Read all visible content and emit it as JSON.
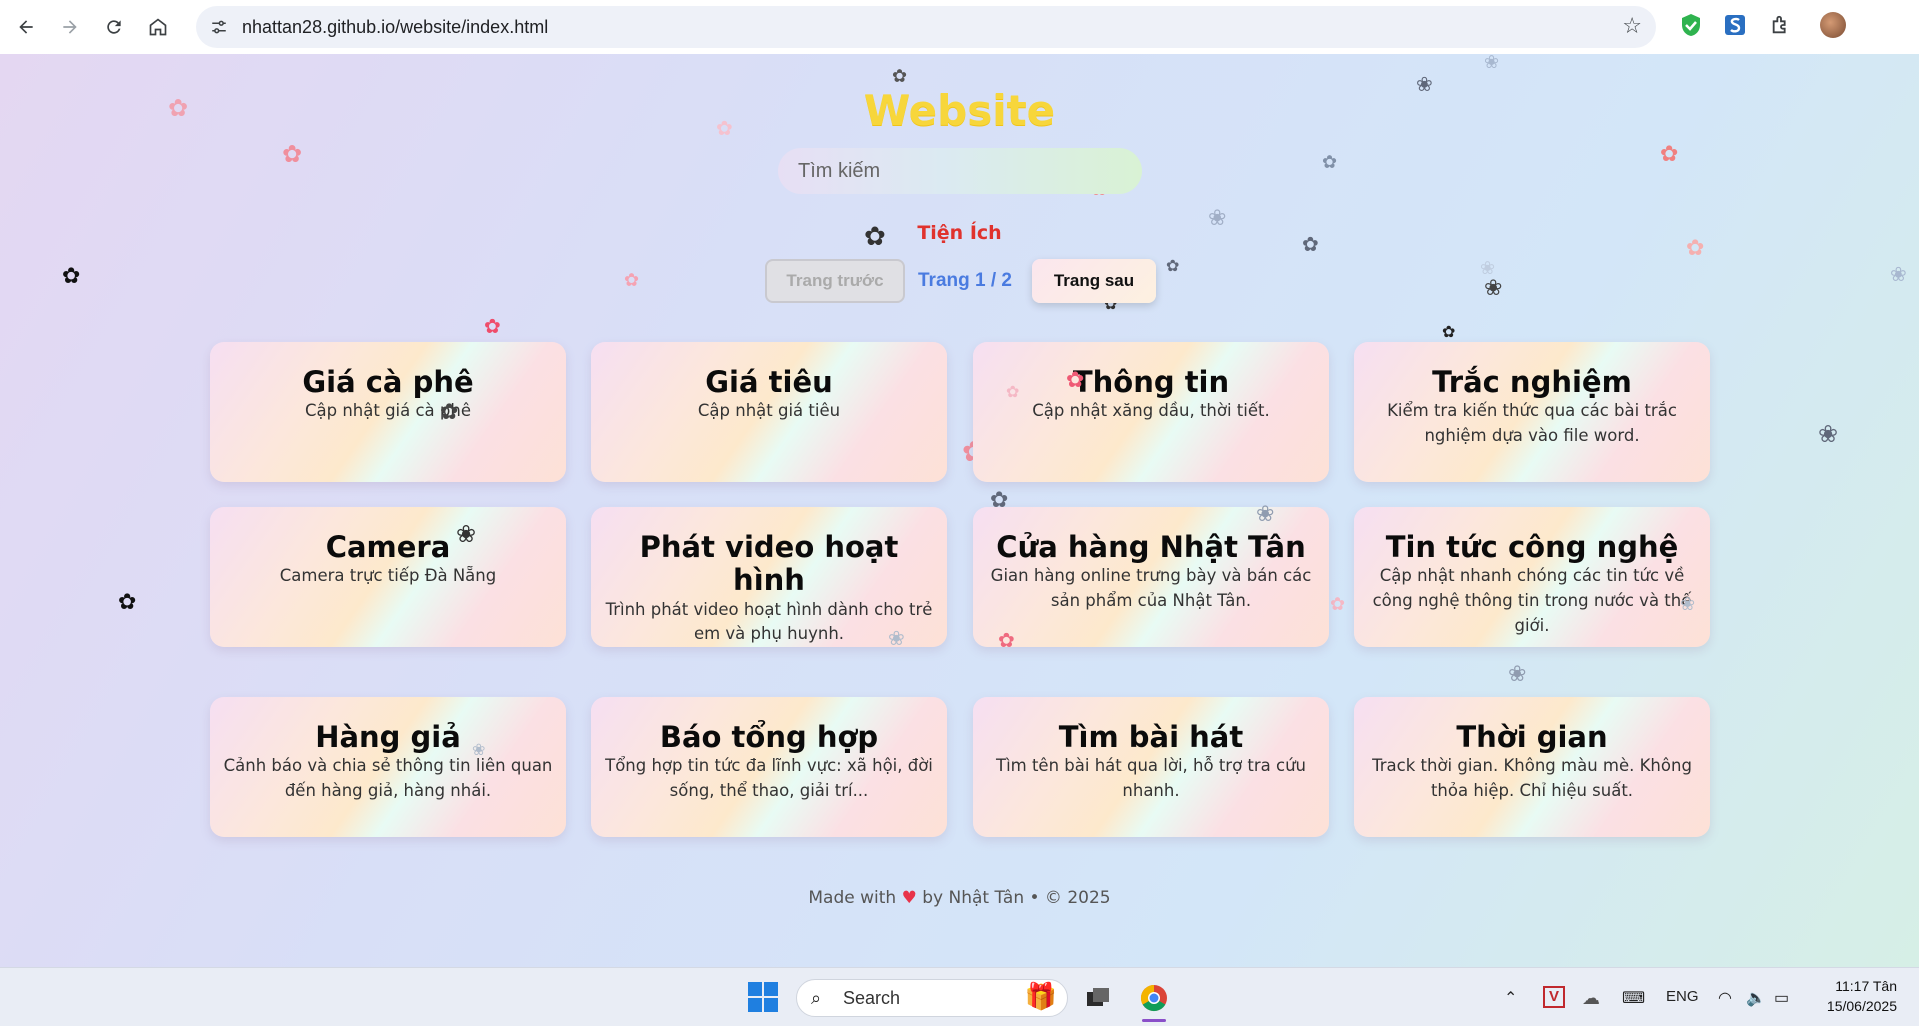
{
  "browser": {
    "url": "nhattan28.github.io/website/index.html"
  },
  "header": {
    "title": "Website",
    "search_placeholder": "Tìm kiếm"
  },
  "section": {
    "title": "Tiện Ích"
  },
  "pager": {
    "prev_label": "Trang trước",
    "page_label": "Trang 1 / 2",
    "next_label": "Trang sau"
  },
  "cards": [
    {
      "title": "Giá cà phê",
      "desc": "Cập nhật giá cà phê"
    },
    {
      "title": "Giá tiêu",
      "desc": "Cập nhật giá tiêu"
    },
    {
      "title": "Thông tin",
      "desc": "Cập nhật xăng dầu, thời tiết."
    },
    {
      "title": "Trắc nghiệm",
      "desc": "Kiểm tra kiến thức qua các bài trắc nghiệm dựa vào file word."
    },
    {
      "title": "Camera",
      "desc": "Camera trực tiếp Đà Nẵng"
    },
    {
      "title": "Phát video hoạt hình",
      "desc": "Trình phát video hoạt hình dành cho trẻ em và phụ huynh."
    },
    {
      "title": "Cửa hàng Nhật Tân",
      "desc": "Gian hàng online trưng bày và bán các sản phẩm của Nhật Tân."
    },
    {
      "title": "Tin tức công nghệ",
      "desc": "Cập nhật nhanh chóng các tin tức về công nghệ thông tin trong nước và thế giới."
    },
    {
      "title": "Hàng giả",
      "desc": "Cảnh báo và chia sẻ thông tin liên quan đến hàng giả, hàng nhái."
    },
    {
      "title": "Báo tổng hợp",
      "desc": "Tổng hợp tin tức đa lĩnh vực: xã hội, đời sống, thể thao, giải trí..."
    },
    {
      "title": "Tìm bài hát",
      "desc": "Tìm tên bài hát qua lời, hỗ trợ tra cứu nhanh."
    },
    {
      "title": "Thời gian",
      "desc": "Track thời gian. Không màu mè. Không thỏa hiệp. Chỉ hiệu suất."
    }
  ],
  "footer": {
    "made_with": "Made with",
    "heart": "♥",
    "by": "by Nhật Tân • © 2025"
  },
  "taskbar": {
    "search_label": "Search",
    "language": "ENG",
    "time": "11:17 Tân",
    "date": "15/06/2025"
  }
}
